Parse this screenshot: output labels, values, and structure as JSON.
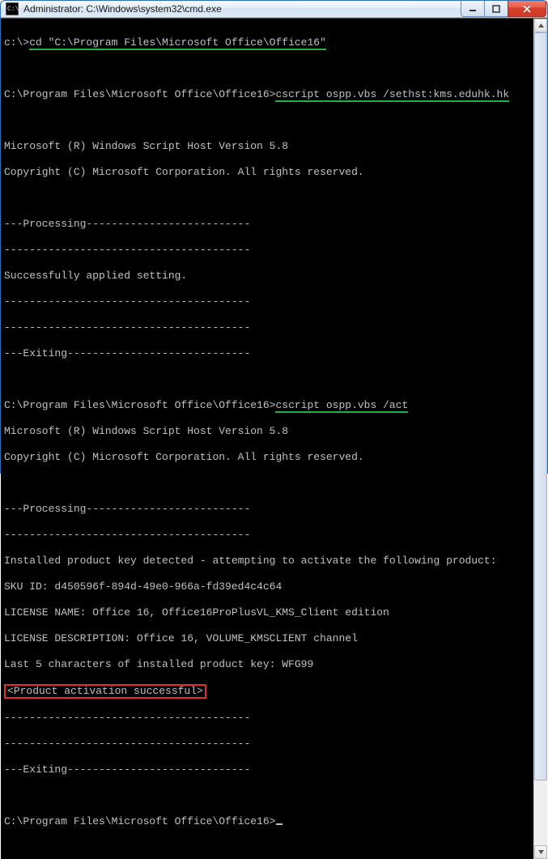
{
  "window": {
    "title": "Administrator: C:\\Windows\\system32\\cmd.exe"
  },
  "console": {
    "prompt1_pre": "c:\\>",
    "cmd1": "cd \"C:\\Program Files\\Microsoft Office\\Office16\"",
    "blank": "",
    "prompt2_pre": "C:\\Program Files\\Microsoft Office\\Office16>",
    "cmd2": "cscript ospp.vbs /sethst:kms.eduhk.hk",
    "wsh1": "Microsoft (R) Windows Script Host Version 5.8",
    "wsh2": "Copyright (C) Microsoft Corporation. All rights reserved.",
    "proc": "---Processing--------------------------",
    "dashes": "---------------------------------------",
    "applied": "Successfully applied setting.",
    "exiting": "---Exiting-----------------------------",
    "cmd3": "cscript ospp.vbs /act",
    "inst": "Installed product key detected - attempting to activate the following product:",
    "sku": "SKU ID: d450596f-894d-49e0-966a-fd39ed4c4c64",
    "lname": "LICENSE NAME: Office 16, Office16ProPlusVL_KMS_Client edition",
    "ldesc": "LICENSE DESCRIPTION: Office 16, VOLUME_KMSCLIENT channel",
    "last5": "Last 5 characters of installed product key: WFG99",
    "success": "<Product activation successful>",
    "final_prompt": "C:\\Program Files\\Microsoft Office\\Office16>"
  }
}
